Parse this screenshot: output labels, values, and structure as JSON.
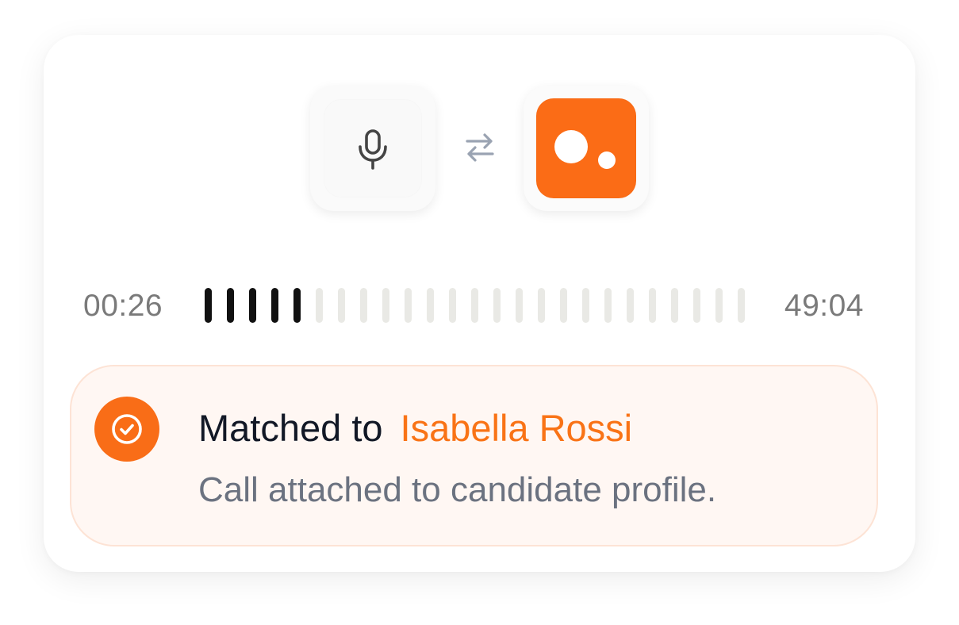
{
  "recording": {
    "source_icon": "microphone-icon",
    "swap_icon": "swap-arrows-icon",
    "target_icon": "app-logo-icon",
    "current_time": "00:26",
    "total_time": "49:04",
    "progress_fraction": 0.2,
    "bar_count": 25,
    "played_bars": 5
  },
  "match": {
    "status_icon": "check-circle-icon",
    "lead_text": "Matched to",
    "candidate_name": "Isabella Rossi",
    "description": "Call attached to candidate profile."
  },
  "colors": {
    "accent": "#f97316",
    "played_bar": "#111111",
    "unplayed_bar": "#e9e9e5",
    "match_bg": "#fff7f3"
  }
}
